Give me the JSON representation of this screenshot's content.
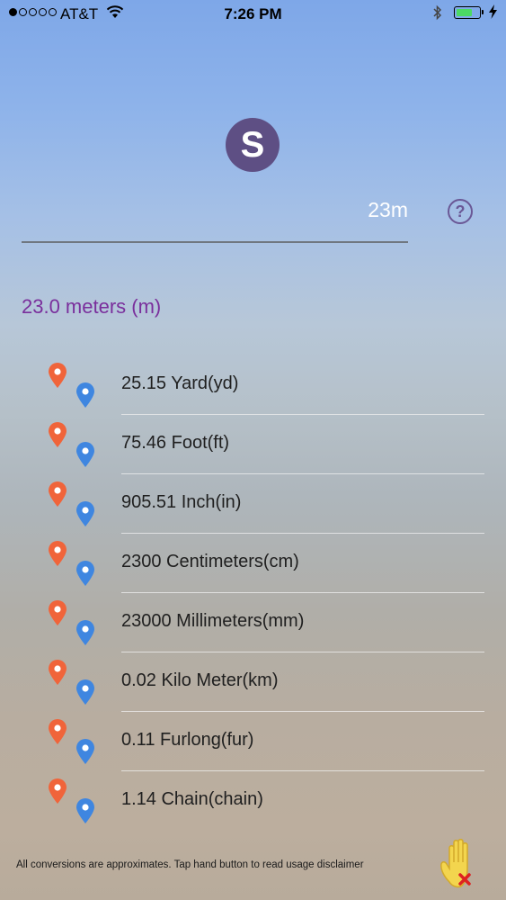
{
  "status_bar": {
    "carrier": "AT&T",
    "time": "7:26 PM",
    "signal_bars": 1,
    "battery_percent": 60,
    "battery_color": "#4cd964"
  },
  "app": {
    "logo_letter": "S",
    "logo_color": "#5e4f84"
  },
  "input": {
    "value": "23m"
  },
  "help_button": {
    "label": "?"
  },
  "result": {
    "title": "23.0 meters (m)"
  },
  "conversions": [
    {
      "label": "25.15 Yard(yd)"
    },
    {
      "label": "75.46 Foot(ft)"
    },
    {
      "label": "905.51 Inch(in)"
    },
    {
      "label": "2300 Centimeters(cm)"
    },
    {
      "label": "23000 Millimeters(mm)"
    },
    {
      "label": "0.02 Kilo Meter(km)"
    },
    {
      "label": "0.11 Furlong(fur)"
    },
    {
      "label": "1.14 Chain(chain)"
    }
  ],
  "icons": {
    "pin_primary": "location-pin-icon",
    "pin_primary_color": "#f0643a",
    "pin_secondary": "location-pin-icon",
    "pin_secondary_color": "#3f86e0",
    "disclaimer_button": "hand-stop-icon"
  },
  "footer": {
    "disclaimer": "All conversions are approximates. Tap hand button to read usage disclaimer"
  }
}
